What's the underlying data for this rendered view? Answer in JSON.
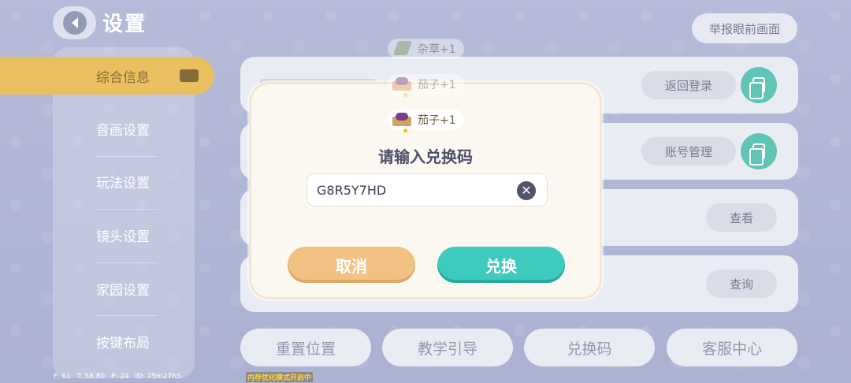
{
  "header": {
    "title": "设置",
    "report_label": "举报眼前画面"
  },
  "sidebar": {
    "items": [
      {
        "label": "综合信息",
        "active": true
      },
      {
        "label": "音画设置",
        "active": false
      },
      {
        "label": "玩法设置",
        "active": false
      },
      {
        "label": "镜头设置",
        "active": false
      },
      {
        "label": "家园设置",
        "active": false
      },
      {
        "label": "按键布局",
        "active": false
      }
    ]
  },
  "content": {
    "rows": [
      {
        "button": "返回登录"
      },
      {
        "button": "账号管理"
      },
      {
        "button": "查看"
      },
      {
        "button": "查询"
      }
    ],
    "bottom_buttons": [
      "重置位置",
      "教学引导",
      "兑换码",
      "客服中心"
    ]
  },
  "dialog": {
    "title": "请输入兑换码",
    "code_value": "G8R5Y7HD",
    "cancel_label": "取消",
    "confirm_label": "兑换"
  },
  "toasts": [
    {
      "label": "杂草+1",
      "icon": "grass-icon"
    },
    {
      "label": "茄子+1",
      "icon": "eggplant-crate-icon"
    },
    {
      "label": "茄子+1",
      "icon": "eggplant-crate-icon"
    }
  ],
  "debug": {
    "f": "F: 61",
    "t": "T: 58.80",
    "p": "P: 24",
    "id": "ID: 75m27h5",
    "memory_tip": "内存优化模式开启中"
  },
  "colors": {
    "accent_active": "#e5b13e",
    "confirm": "#3ccbbe",
    "cancel": "#f2c184",
    "copy_button": "#3cb9a8"
  }
}
